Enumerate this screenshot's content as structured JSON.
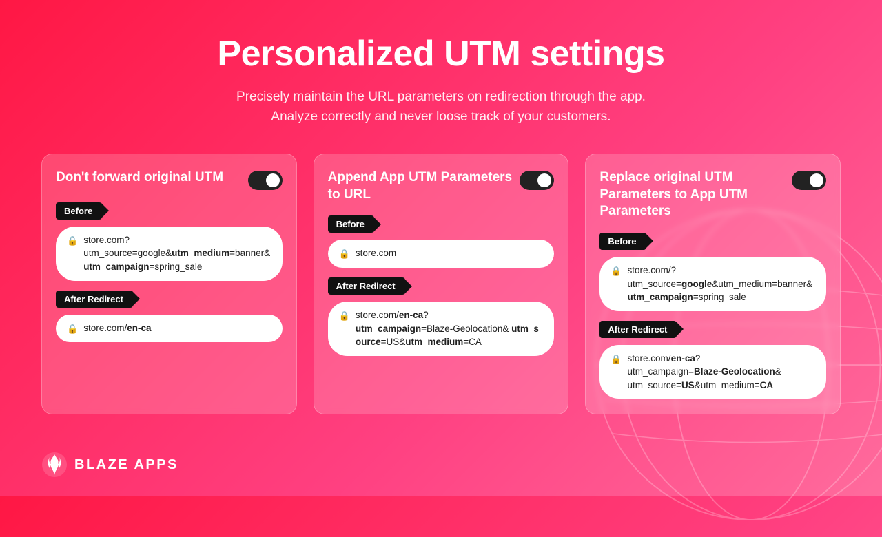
{
  "header": {
    "title": "Personalized UTM settings",
    "subtitle_line1": "Precisely maintain the URL parameters on redirection through the app.",
    "subtitle_line2": "Analyze correctly and never loose track of your customers."
  },
  "cards": [
    {
      "id": "card1",
      "title": "Don't forward original UTM",
      "toggle_on": true,
      "before_label": "Before",
      "before_url": "store.com?\nutm_source=google&utm_medium=banner&utm_campaign=spring_sale",
      "before_url_plain": "store.com?",
      "before_url_normal": "utm_source=google&",
      "before_url_bold1": "utm_medium",
      "before_url_mid": "=banner&",
      "before_url_bold2": "utm_campaign",
      "before_url_end": "=spring_sale",
      "after_label": "After Redirect",
      "after_url_plain": "store.com/",
      "after_url_bold": "en-ca"
    },
    {
      "id": "card2",
      "title": "Append App UTM Parameters to URL",
      "toggle_on": true,
      "before_label": "Before",
      "before_url_plain": "store.com",
      "after_label": "After Redirect",
      "after_url_plain": "store.com/",
      "after_url_bold1": "en-ca",
      "after_url_q": "?",
      "after_url_param1_bold": "utm_campaign",
      "after_url_param1_eq": "=Blaze-Geolocation& ",
      "after_url_param2_bold": "utm_source",
      "after_url_param2_eq": "=US&",
      "after_url_param3_bold": "utm_medium",
      "after_url_param3_eq": "=CA"
    },
    {
      "id": "card3",
      "title": "Replace original UTM Parameters to App UTM Parameters",
      "toggle_on": true,
      "before_label": "Before",
      "before_url_plain": "store.com/?",
      "before_url_param1_normal": "utm_source=",
      "before_url_param1_bold": "google",
      "before_url_param2_normal": "&utm_medium=banner&",
      "before_url_param2_bold": "utm_campaign",
      "before_url_param2_end": "=spring_sale",
      "after_label": "After Redirect",
      "after_url_plain": "store.com/",
      "after_url_bold1": "en-ca",
      "after_url_q": "?",
      "after_url_param1_normal": "utm_campaign=",
      "after_url_param1_bold": "Blaze-Geolocation",
      "after_url_param1_end": "&",
      "after_url_param2_normal": "utm_source=",
      "after_url_param2_bold": "US",
      "after_url_param3_normal": "&utm_medium=",
      "after_url_param3_bold": "CA"
    }
  ],
  "branding": {
    "name": "BLAZE APPS"
  }
}
